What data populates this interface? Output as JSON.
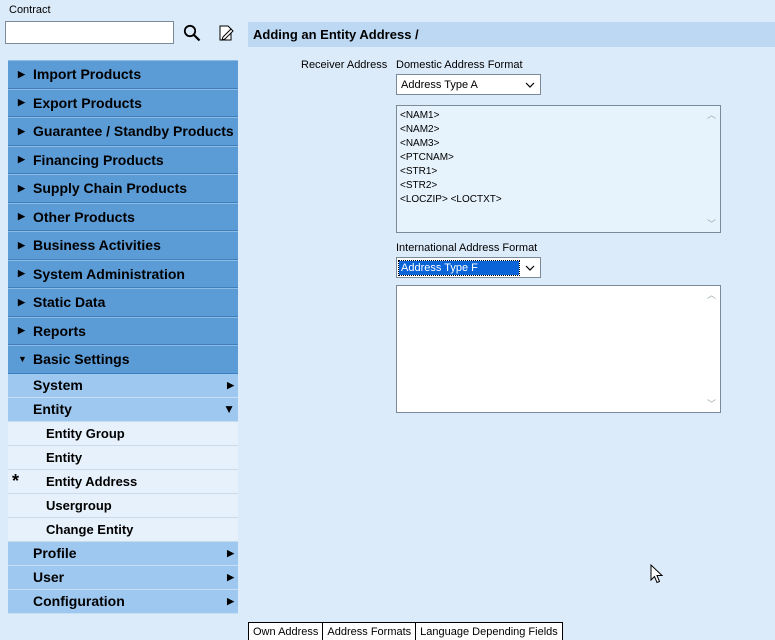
{
  "sidebar": {
    "contract_label": "Contract",
    "contract_value": "",
    "menu": [
      {
        "label": "Import Products"
      },
      {
        "label": "Export Products"
      },
      {
        "label": "Guarantee / Standby Products"
      },
      {
        "label": "Financing Products"
      },
      {
        "label": "Supply Chain Products"
      },
      {
        "label": "Other Products"
      },
      {
        "label": "Business Activities"
      },
      {
        "label": "System Administration"
      },
      {
        "label": "Static Data"
      },
      {
        "label": "Reports"
      },
      {
        "label": "Basic Settings"
      }
    ],
    "basic_settings": {
      "system": "System",
      "entity": "Entity",
      "entity_children": [
        "Entity Group",
        "Entity",
        "Entity Address",
        "Usergroup",
        "Change Entity"
      ],
      "selected_marker": "*",
      "profile": "Profile",
      "user": "User",
      "configuration": "Configuration"
    }
  },
  "main": {
    "title": "Adding an Entity Address /",
    "receiver_label": "Receiver Address",
    "domestic_label": "Domestic Address Format",
    "domestic_value": "Address Type A",
    "domestic_text": "<NAM1>\n<NAM2>\n<NAM3>\n<PTCNAM>\n<STR1>\n<STR2>\n<LOCZIP> <LOCTXT>",
    "international_label": "International Address Format",
    "international_value": "Address Type F",
    "international_text": ""
  },
  "tabs": [
    "Own Address",
    "Address Formats",
    "Language Depending Fields"
  ]
}
